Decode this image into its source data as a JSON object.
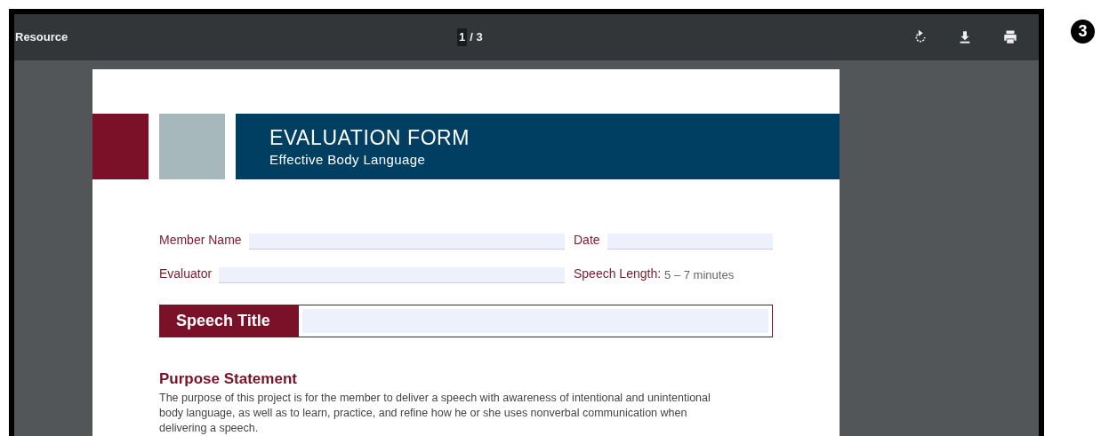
{
  "viewer": {
    "title": "Resource",
    "page_current": "1",
    "page_total": "/ 3"
  },
  "step_badge": "3",
  "form": {
    "title": "EVALUATION FORM",
    "subtitle": "Effective Body Language",
    "fields": [
      {
        "label": "Member Name",
        "kind": "input"
      },
      {
        "label": "Date",
        "kind": "input"
      },
      {
        "label": "Evaluator",
        "kind": "input"
      },
      {
        "label": "Speech Length:",
        "kind": "value",
        "value": "5 – 7 minutes"
      }
    ],
    "speech_title_label": "Speech Title",
    "purpose_heading": "Purpose Statement",
    "purpose_text": "The purpose of this project is for the member to deliver a speech with awareness of intentional and unintentional body language, as well as to learn, practice, and refine how he or she uses nonverbal communication when delivering a speech."
  }
}
